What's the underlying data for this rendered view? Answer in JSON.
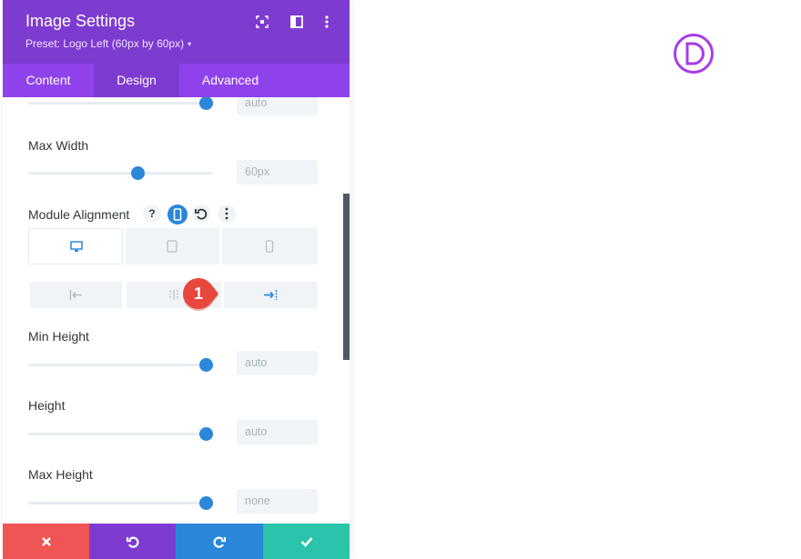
{
  "header": {
    "title": "Image Settings",
    "preset": "Preset: Logo Left (60px by 60px)",
    "preset_caret": "▾"
  },
  "tabs": [
    {
      "label": "Content",
      "active": false
    },
    {
      "label": "Design",
      "active": true
    },
    {
      "label": "Advanced",
      "active": false
    }
  ],
  "fields": {
    "width_value": "auto",
    "max_width": {
      "label": "Max Width",
      "value": "60px"
    },
    "module_alignment": {
      "label": "Module Alignment",
      "help": "?"
    },
    "min_height": {
      "label": "Min Height",
      "value": "auto"
    },
    "height": {
      "label": "Height",
      "value": "auto"
    },
    "max_height": {
      "label": "Max Height",
      "value": "none"
    }
  },
  "badge": {
    "number": "1"
  },
  "colors": {
    "header": "#7e3bd0",
    "tabs": "#8f42ec",
    "accent_blue": "#2b87da",
    "discard": "#ef5555",
    "save": "#29c4a9",
    "badge": "#e8473c",
    "logo": "#a93ce6"
  }
}
